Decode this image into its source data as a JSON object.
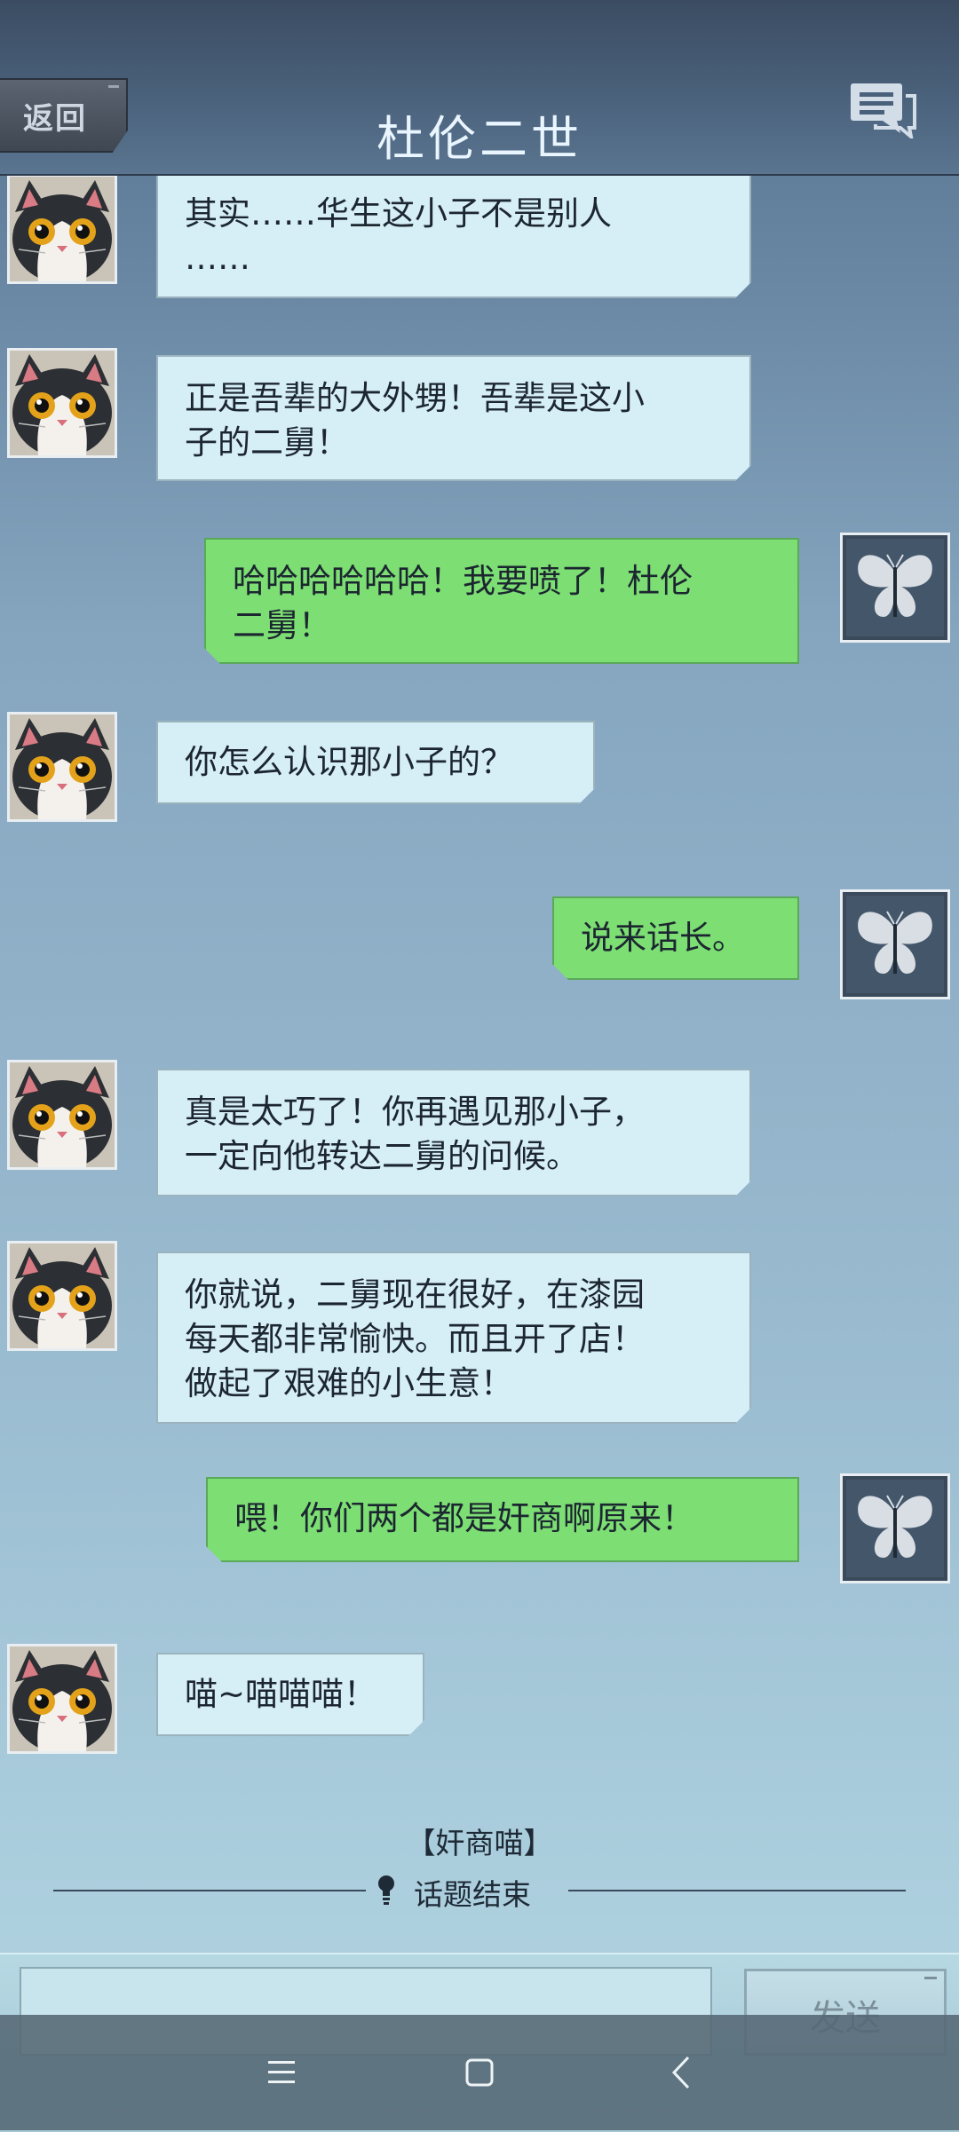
{
  "header": {
    "back_label": "返回",
    "title": "杜伦二世"
  },
  "messages": [
    {
      "side": "left",
      "text": "其实……华生这小子不是别人……"
    },
    {
      "side": "left",
      "text": "正是吾辈的大外甥！吾辈是这小子的二舅！"
    },
    {
      "side": "right",
      "text": "哈哈哈哈哈哈！我要喷了！杜伦二舅！"
    },
    {
      "side": "left",
      "text": "你怎么认识那小子的？"
    },
    {
      "side": "right",
      "text": "说来话长。"
    },
    {
      "side": "left",
      "text": "真是太巧了！你再遇见那小子，一定向他转达二舅的问候。"
    },
    {
      "side": "left",
      "text": "你就说，二舅现在很好，在漆园每天都非常愉快。而且开了店！做起了艰难的小生意！"
    },
    {
      "side": "right",
      "text": "喂！你们两个都是奸商啊原来！"
    },
    {
      "side": "left",
      "text": "喵~喵喵喵！"
    }
  ],
  "lines": {
    "m0": [
      "其实……华生这小子不是别人",
      "……"
    ],
    "m1": [
      "正是吾辈的大外甥！吾辈是这小",
      "子的二舅！"
    ],
    "m2": [
      "哈哈哈哈哈哈！我要喷了！杜伦",
      "二舅！"
    ],
    "m3": [
      "你怎么认识那小子的？"
    ],
    "m4": [
      "说来话长。"
    ],
    "m5": [
      "真是太巧了！你再遇见那小子，",
      "一定向他转达二舅的问候。"
    ],
    "m6": [
      "你就说，二舅现在很好，在漆园",
      "每天都非常愉快。而且开了店！",
      "做起了艰难的小生意！"
    ],
    "m7": [
      "喂！你们两个都是奸商啊原来！"
    ],
    "m8": [
      "喵~喵喵喵！"
    ]
  },
  "topic": {
    "name": "【奸商喵】",
    "end_label": "话题结束"
  },
  "composer": {
    "input_value": "",
    "send_label": "发送"
  },
  "icons": {
    "header_right": "chat-bubbles-icon",
    "npc_avatar": "cat-avatar",
    "player_avatar": "butterfly-avatar",
    "topic_end": "lightbulb-icon",
    "nav": [
      "menu-icon",
      "home-icon",
      "back-icon"
    ]
  },
  "colors": {
    "npc_bubble": "#d6eef5",
    "player_bubble": "#7dde74",
    "title_text": "#eaf6ff"
  }
}
